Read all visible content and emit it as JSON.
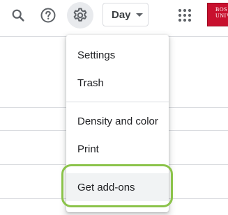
{
  "toolbar": {
    "search_icon": "search-icon",
    "help_icon": "help-icon",
    "settings_icon": "gear-icon",
    "view_select": {
      "selected": "Day"
    },
    "apps_icon": "apps-grid-icon",
    "avatar": {
      "line1": "BOS",
      "line2": "UNIV"
    }
  },
  "settings_menu": {
    "items": [
      {
        "label": "Settings"
      },
      {
        "label": "Trash"
      },
      {
        "label": "Density and color"
      },
      {
        "label": "Print"
      },
      {
        "label": "Get add-ons"
      }
    ],
    "highlight_color": "#8bc34a"
  }
}
